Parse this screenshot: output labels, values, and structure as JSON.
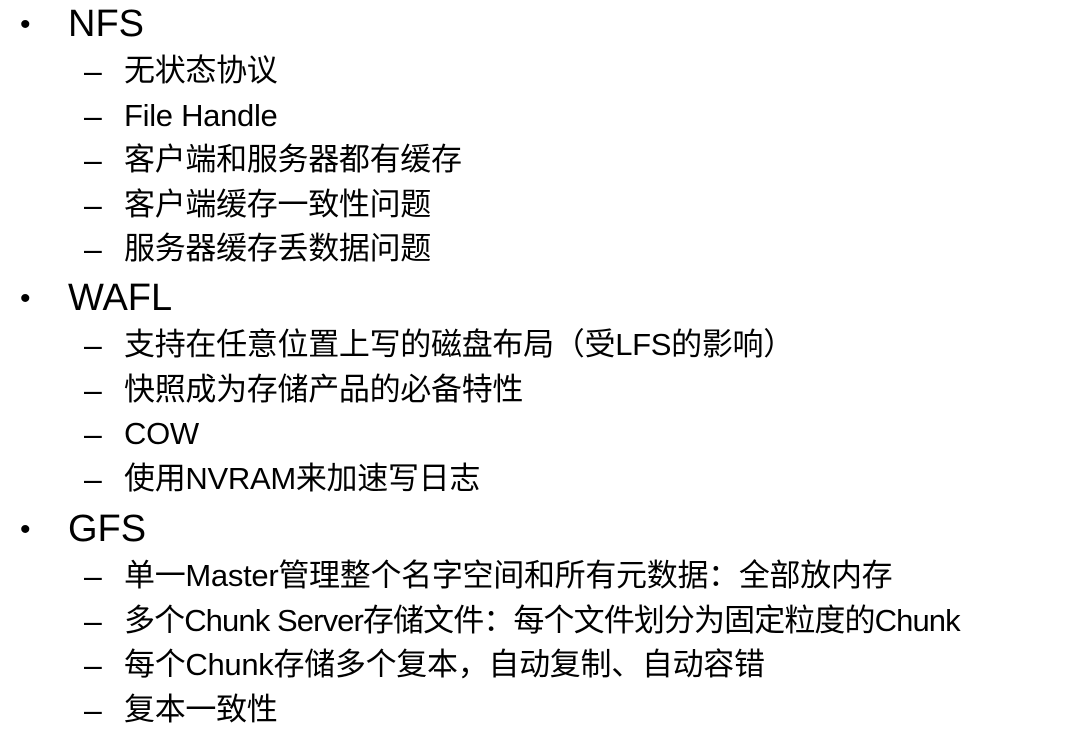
{
  "topics": [
    {
      "bullet": "•",
      "title": "NFS",
      "items": [
        {
          "dash": "–",
          "text": "无状态协议"
        },
        {
          "dash": "–",
          "text": "File Handle"
        },
        {
          "dash": "–",
          "text": "客户端和服务器都有缓存"
        },
        {
          "dash": "–",
          "text": "客户端缓存一致性问题"
        },
        {
          "dash": "–",
          "text": "服务器缓存丢数据问题"
        }
      ]
    },
    {
      "bullet": "•",
      "title": "WAFL",
      "items": [
        {
          "dash": "–",
          "text": "支持在任意位置上写的磁盘布局（受LFS的影响）"
        },
        {
          "dash": "–",
          "text": "快照成为存储产品的必备特性"
        },
        {
          "dash": "–",
          "text": "COW"
        },
        {
          "dash": "–",
          "text": "使用NVRAM来加速写日志"
        }
      ]
    },
    {
      "bullet": "•",
      "title": "GFS",
      "items": [
        {
          "dash": "–",
          "text": "单一Master管理整个名字空间和所有元数据：全部放内存"
        },
        {
          "dash": "–",
          "text": "多个Chunk Server存储文件：每个文件划分为固定粒度的Chunk"
        },
        {
          "dash": "–",
          "text": "每个Chunk存储多个复本，自动复制、自动容错"
        },
        {
          "dash": "–",
          "text": "复本一致性"
        }
      ]
    }
  ]
}
